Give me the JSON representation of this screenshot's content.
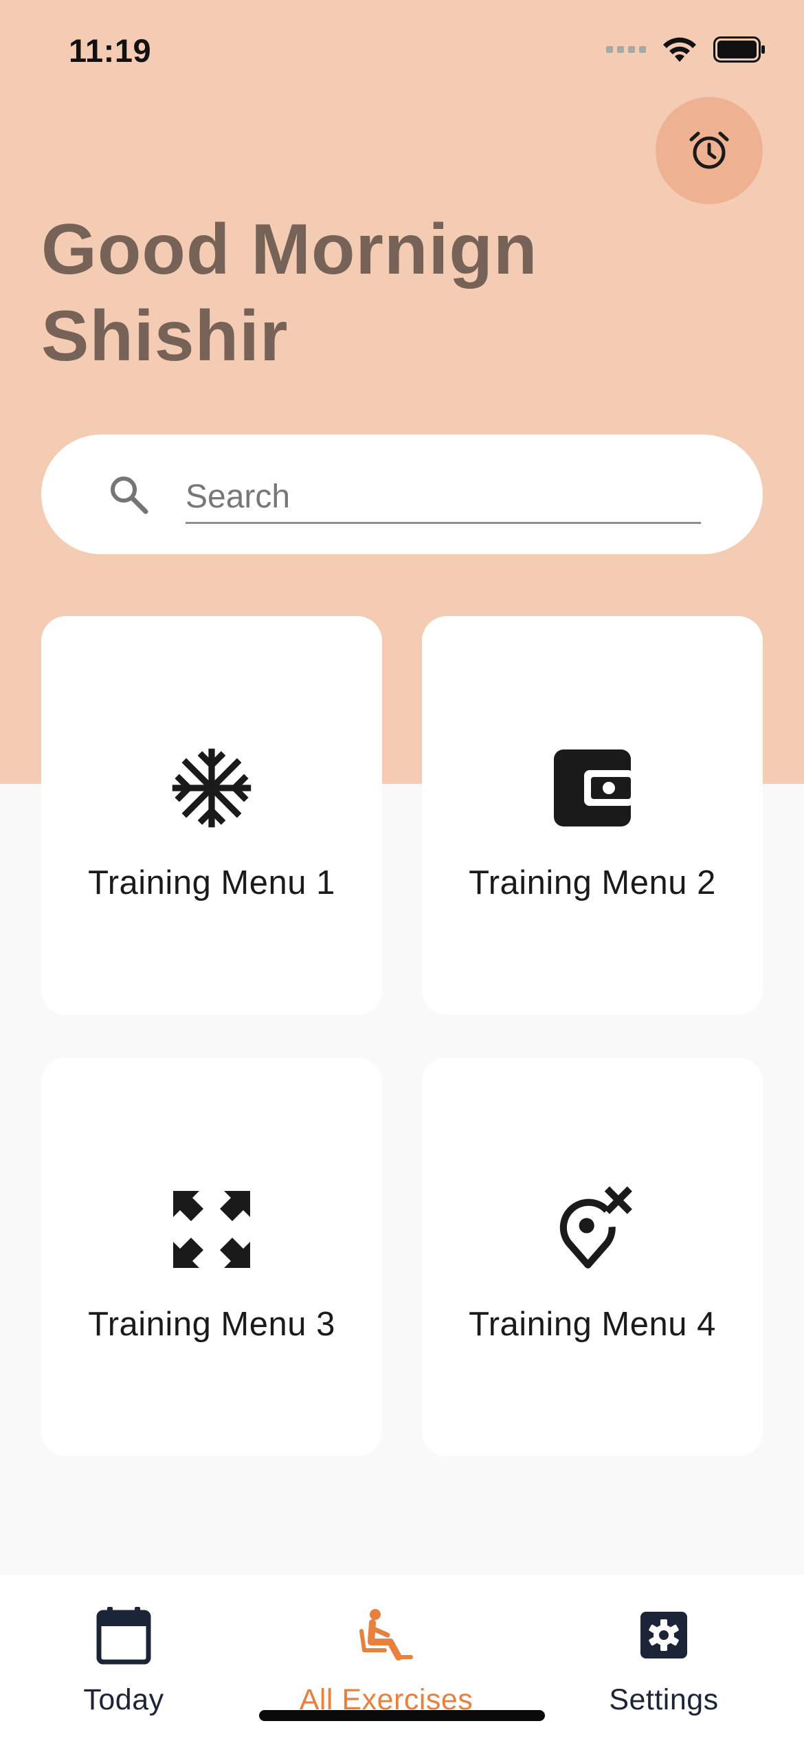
{
  "status_bar": {
    "time": "11:19"
  },
  "header": {
    "greeting_line1": "Good Mornign",
    "greeting_line2": "Shishir",
    "alarm_icon": "alarm-clock-icon"
  },
  "search": {
    "placeholder": "Search",
    "value": ""
  },
  "menus": [
    {
      "label": "Training Menu 1",
      "icon": "snowflake-icon"
    },
    {
      "label": "Training Menu 2",
      "icon": "wallet-icon"
    },
    {
      "label": "Training Menu 3",
      "icon": "expand-arrows-icon"
    },
    {
      "label": "Training Menu 4",
      "icon": "location-remove-icon"
    }
  ],
  "nav": {
    "items": [
      {
        "label": "Today",
        "icon": "calendar-icon",
        "active": false
      },
      {
        "label": "All Exercises",
        "icon": "seated-person-icon",
        "active": true
      },
      {
        "label": "Settings",
        "icon": "gear-icon",
        "active": false
      }
    ],
    "active_color": "#e8803e",
    "inactive_color": "#1c2438"
  },
  "colors": {
    "hero_background": "#f4ccb4",
    "greeting_text": "#776258",
    "alarm_button": "#eeb293",
    "page_background": "#f9f9f9"
  }
}
